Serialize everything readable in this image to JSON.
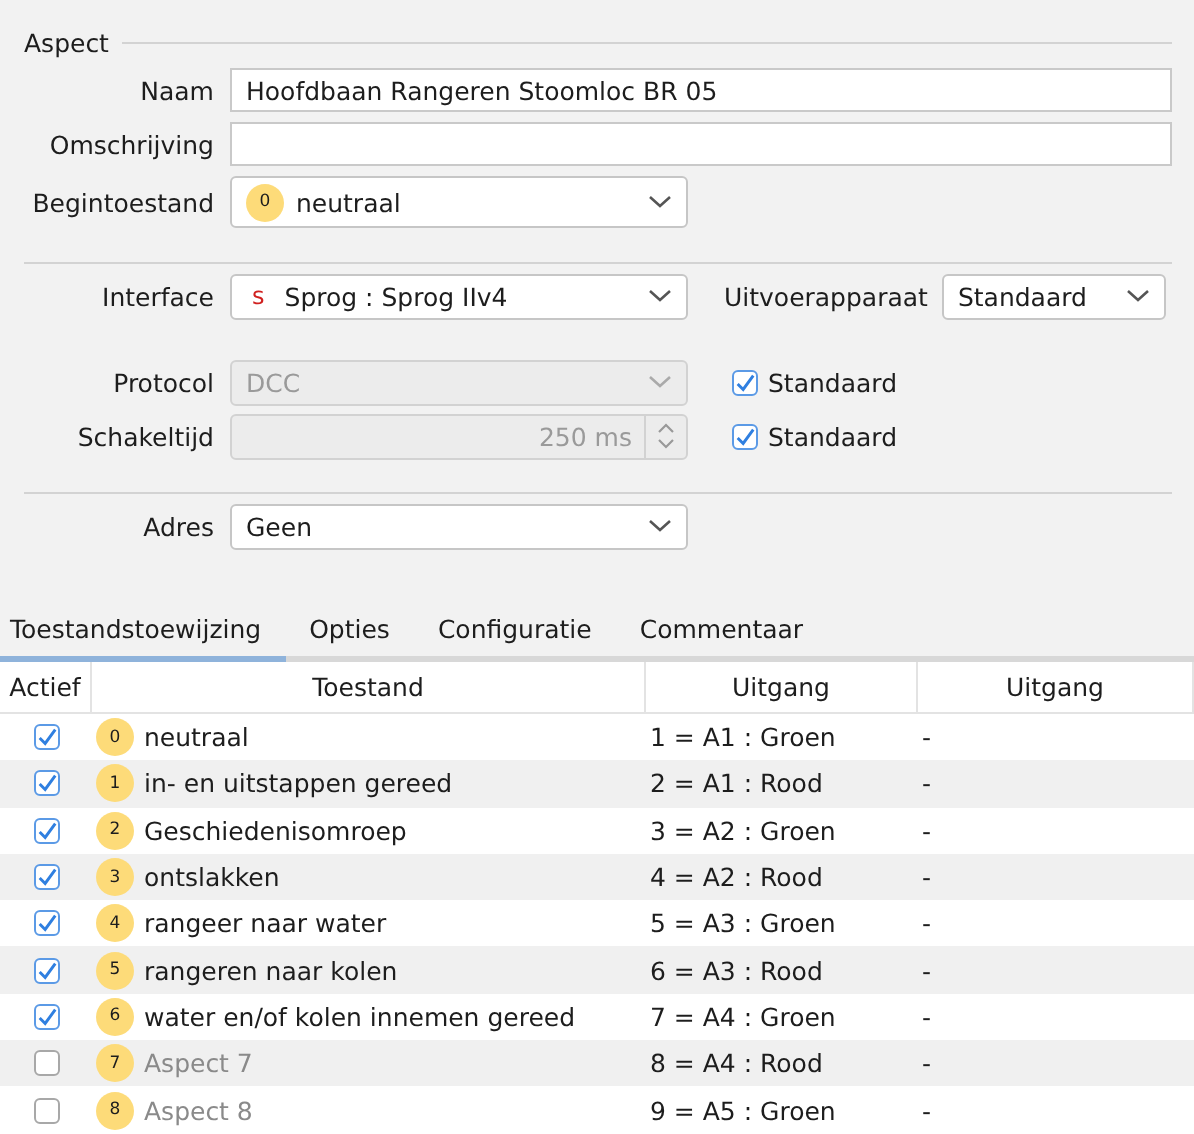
{
  "section_title": "Aspect",
  "naam": {
    "label": "Naam",
    "value": "Hoofdbaan Rangeren Stoomloc BR 05"
  },
  "omschrijving": {
    "label": "Omschrijving"
  },
  "begintoestand": {
    "label": "Begintoestand",
    "badge": "0",
    "value": "neutraal"
  },
  "interface": {
    "label": "Interface",
    "icon_letter": "s",
    "value": "Sprog : Sprog IIv4"
  },
  "uitvoerapparaat": {
    "label": "Uitvoerapparaat",
    "value": "Standaard"
  },
  "protocol": {
    "label": "Protocol",
    "value": "DCC",
    "disabled": true,
    "default": {
      "label": "Standaard",
      "checked": true
    }
  },
  "schakeltijd": {
    "label": "Schakeltijd",
    "value": "250 ms",
    "disabled": true,
    "default": {
      "label": "Standaard",
      "checked": true
    }
  },
  "adres": {
    "label": "Adres",
    "value": "Geen"
  },
  "tabs": [
    {
      "label": "Toestandstoewijzing",
      "selected": true
    },
    {
      "label": "Opties",
      "selected": false
    },
    {
      "label": "Configuratie",
      "selected": false
    },
    {
      "label": "Commentaar",
      "selected": false
    }
  ],
  "table": {
    "columns": [
      "Actief",
      "Toestand",
      "Uitgang",
      "Uitgang"
    ],
    "rows": [
      {
        "checked": true,
        "badge": "0",
        "state": "neutraal",
        "output_1": "1 = A1 : Groen",
        "output_2": "-"
      },
      {
        "checked": true,
        "badge": "1",
        "state": "in- en uitstappen gereed",
        "output_1": "2 = A1 : Rood",
        "output_2": "-"
      },
      {
        "checked": true,
        "badge": "2",
        "state": "Geschiedenisomroep",
        "output_1": "3 = A2 : Groen",
        "output_2": "-"
      },
      {
        "checked": true,
        "badge": "3",
        "state": "ontslakken",
        "output_1": "4 = A2 : Rood",
        "output_2": "-"
      },
      {
        "checked": true,
        "badge": "4",
        "state": "rangeer naar water",
        "output_1": "5 = A3 : Groen",
        "output_2": "-"
      },
      {
        "checked": true,
        "badge": "5",
        "state": "rangeren naar kolen",
        "output_1": "6 = A3 : Rood",
        "output_2": "-"
      },
      {
        "checked": true,
        "badge": "6",
        "state": "water en/of kolen innemen gereed",
        "output_1": "7 = A4 : Groen",
        "output_2": "-"
      },
      {
        "checked": false,
        "badge": "7",
        "state": "Aspect 7",
        "output_1": "8 = A4 : Rood",
        "output_2": "-"
      },
      {
        "checked": false,
        "badge": "8",
        "state": "Aspect 8",
        "output_1": "9 = A5 : Groen",
        "output_2": "-"
      }
    ]
  }
}
